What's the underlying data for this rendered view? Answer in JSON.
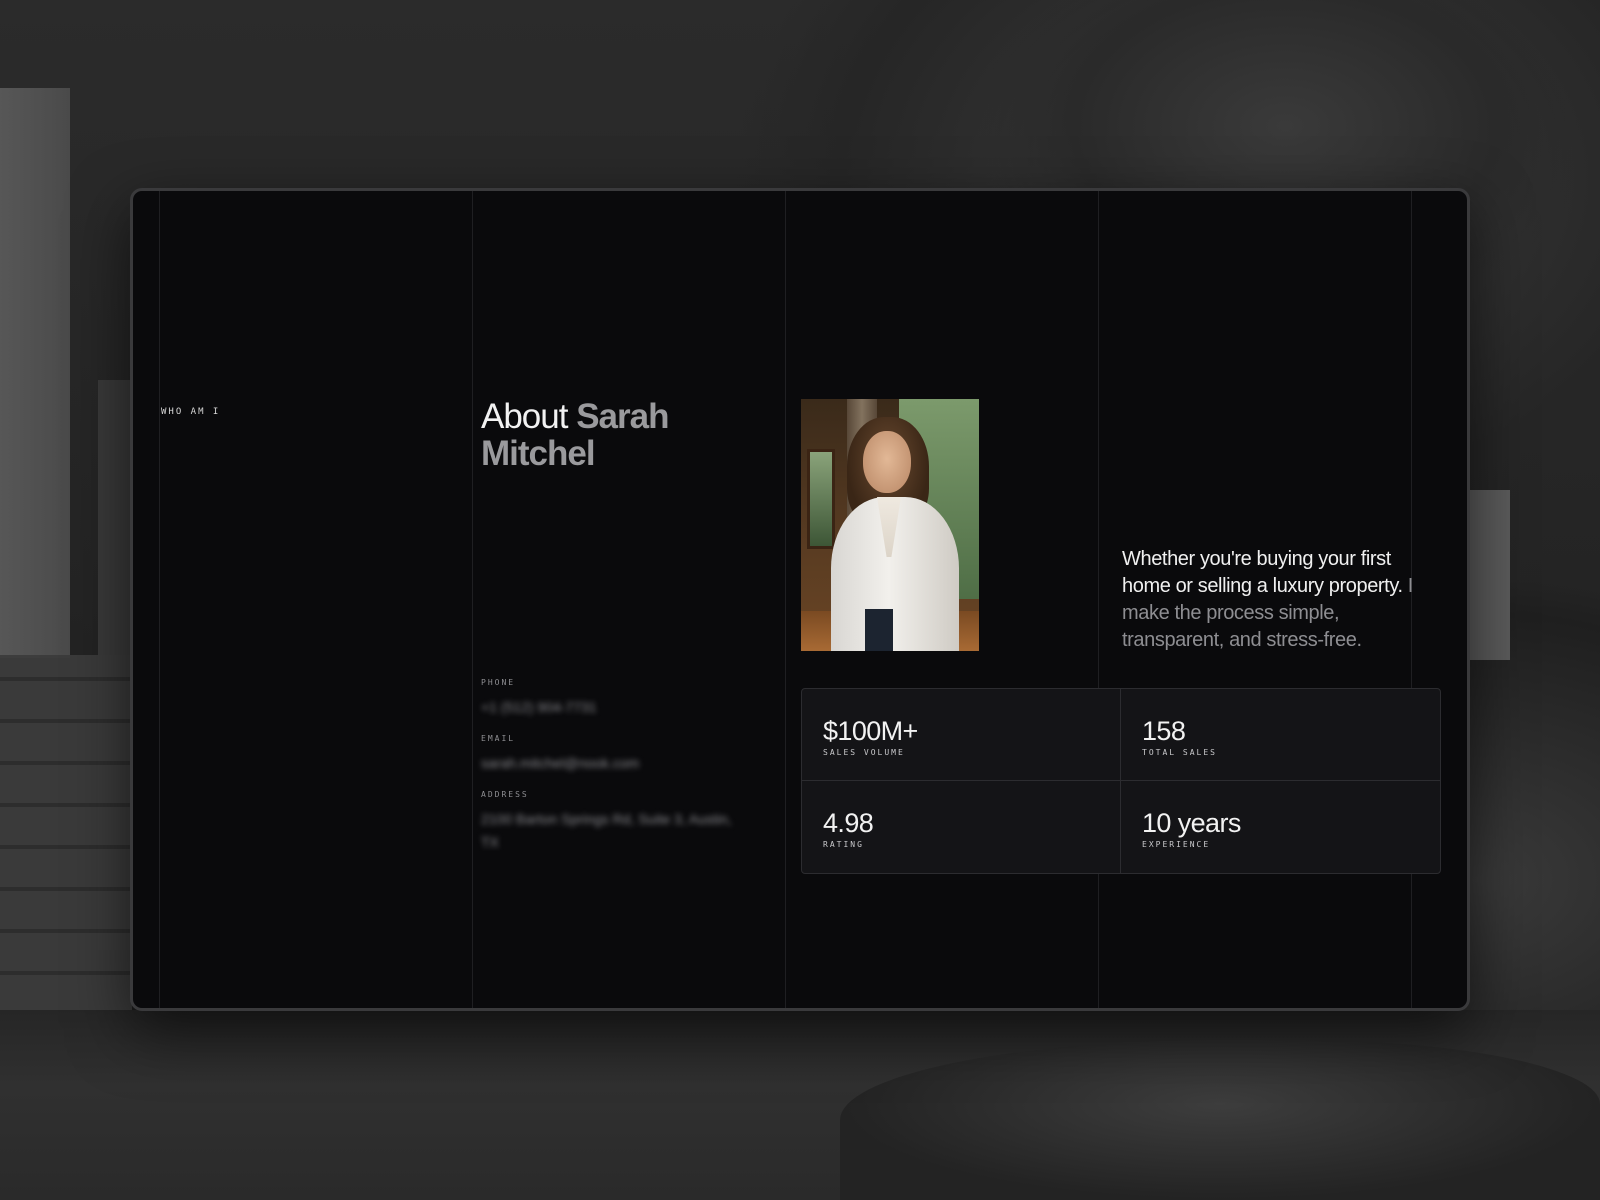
{
  "section": {
    "eyebrow": "WHO AM I",
    "title_strong": "About",
    "title_muted": "Sarah Mitchel"
  },
  "contact": {
    "phone_label": "PHONE",
    "phone_value": "+1 (512) 904-7731",
    "email_label": "EMAIL",
    "email_value": "sarah.mitchel@nook.com",
    "address_label": "ADDRESS",
    "address_value": "2100 Barton Springs Rd, Suite 3, Austin, TX"
  },
  "photo": {
    "icon": "agent-portrait"
  },
  "blurb": {
    "strong": "Whether you're buying your first home or selling a luxury property.",
    "muted": "I make the process simple, transparent, and stress-free."
  },
  "stats": [
    {
      "value": "$100M+",
      "label": "SALES VOLUME"
    },
    {
      "value": "158",
      "label": "TOTAL SALES"
    },
    {
      "value": "4.98",
      "label": "RATING"
    },
    {
      "value": "10 years",
      "label": "EXPERIENCE"
    }
  ]
}
